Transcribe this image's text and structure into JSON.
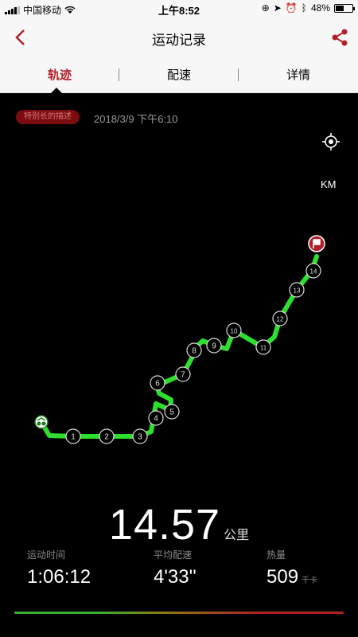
{
  "status_bar": {
    "carrier": "中国移动",
    "time": "上午8:52",
    "battery": "48%",
    "battery_level": 0.48
  },
  "nav": {
    "title": "运动记录",
    "back_icon": "chevron-left-icon",
    "share_icon": "share-icon"
  },
  "tabs": [
    {
      "label": "轨迹",
      "active": true
    },
    {
      "label": "配速",
      "active": false
    },
    {
      "label": "详情",
      "active": false
    }
  ],
  "map": {
    "badge": "特别长的描述",
    "date": "2018/3/9 下午6:10",
    "unit_label": "KM",
    "km_markers": [
      "1",
      "2",
      "3",
      "4",
      "5",
      "6",
      "7",
      "8",
      "9",
      "10",
      "11",
      "12",
      "13",
      "14"
    ]
  },
  "summary": {
    "distance": "14.57",
    "distance_unit": "公里",
    "stats": [
      {
        "label": "运动时间",
        "value": "1:06:12",
        "unit": ""
      },
      {
        "label": "平均配速",
        "value": "4'33''",
        "unit": ""
      },
      {
        "label": "热量",
        "value": "509",
        "unit": "千卡"
      }
    ]
  },
  "colors": {
    "accent": "#b0202a",
    "route": "#2ee02e",
    "background": "#000000"
  }
}
